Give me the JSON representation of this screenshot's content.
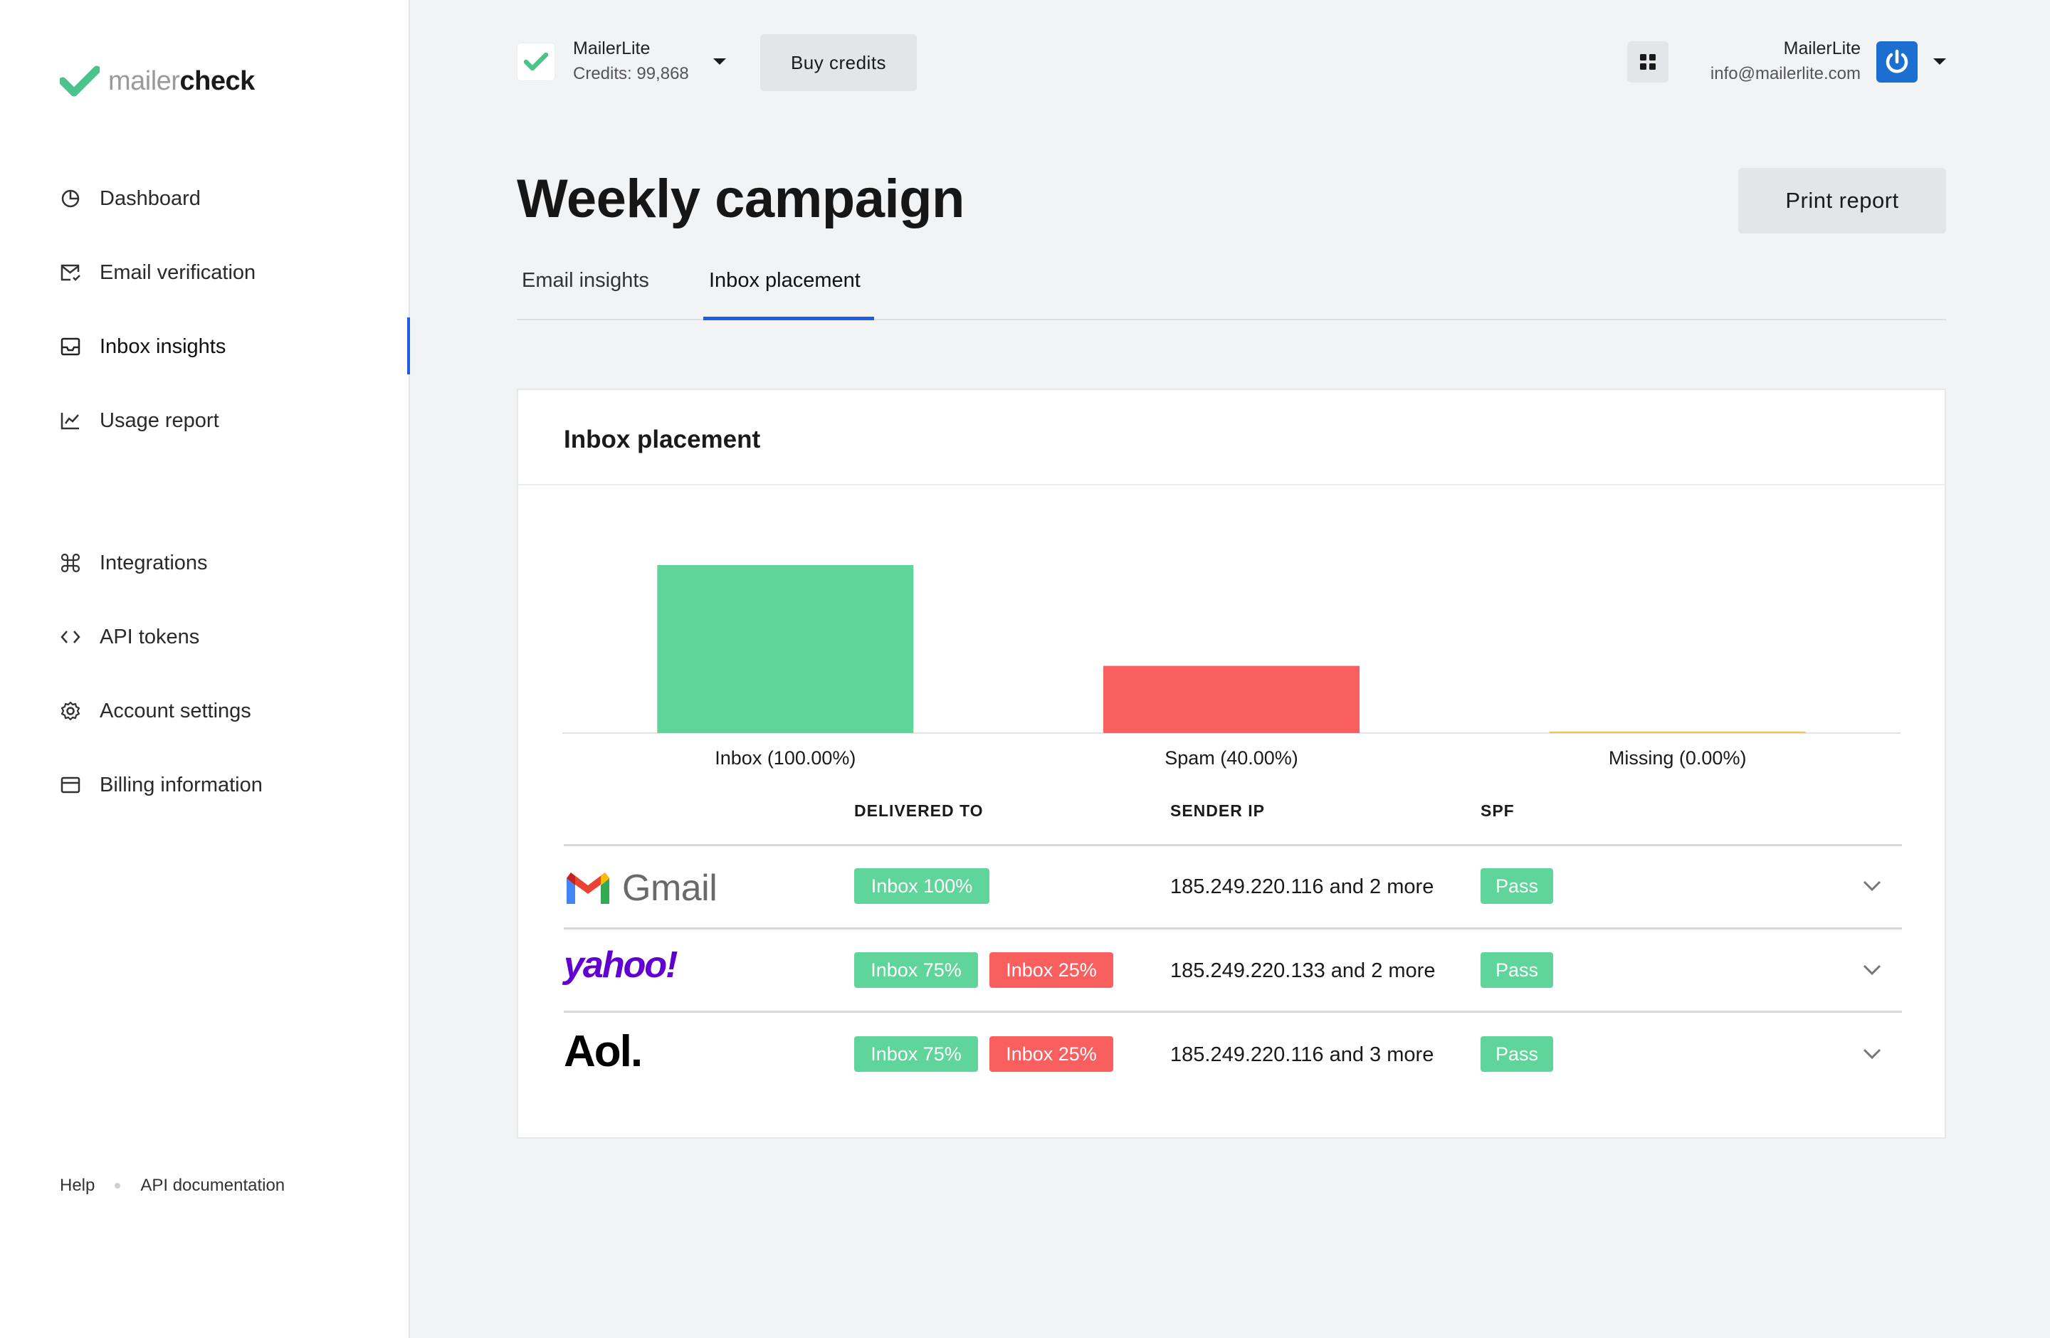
{
  "brand": {
    "logo_light": "mailer",
    "logo_bold": "check",
    "accent": "#5fd59b"
  },
  "sidebar": {
    "items": [
      {
        "label": "Dashboard",
        "icon": "pie-chart-icon"
      },
      {
        "label": "Email verification",
        "icon": "mail-check-icon"
      },
      {
        "label": "Inbox insights",
        "icon": "inbox-icon",
        "active": true
      },
      {
        "label": "Usage report",
        "icon": "line-chart-icon"
      },
      {
        "label": "Integrations",
        "icon": "command-icon"
      },
      {
        "label": "API tokens",
        "icon": "code-icon"
      },
      {
        "label": "Account settings",
        "icon": "gear-icon"
      },
      {
        "label": "Billing information",
        "icon": "billing-card-icon"
      }
    ],
    "footer": {
      "help": "Help",
      "api_docs": "API documentation"
    }
  },
  "topbar": {
    "account_name": "MailerLite",
    "credits": "Credits: 99,868",
    "buy_credits": "Buy credits",
    "user_name": "MailerLite",
    "user_email": "info@mailerlite.com"
  },
  "page": {
    "title": "Weekly campaign",
    "print_button": "Print report",
    "tabs": [
      {
        "label": "Email insights",
        "active": false
      },
      {
        "label": "Inbox placement",
        "active": true
      }
    ]
  },
  "card": {
    "title": "Inbox placement",
    "table_headers": {
      "delivered_to": "DELIVERED TO",
      "sender_ip": "SENDER IP",
      "spf": "SPF"
    },
    "rows": [
      {
        "provider": "Gmail",
        "delivered": [
          {
            "label": "Inbox 100%",
            "color": "green"
          }
        ],
        "sender_ip": "185.249.220.116 and 2 more",
        "spf": "Pass"
      },
      {
        "provider": "yahoo!",
        "delivered": [
          {
            "label": "Inbox 75%",
            "color": "green"
          },
          {
            "label": "Inbox 25%",
            "color": "red"
          }
        ],
        "sender_ip": "185.249.220.133 and 2 more",
        "spf": "Pass"
      },
      {
        "provider": "Aol.",
        "delivered": [
          {
            "label": "Inbox 75%",
            "color": "green"
          },
          {
            "label": "Inbox 25%",
            "color": "red"
          }
        ],
        "sender_ip": "185.249.220.116 and 3 more",
        "spf": "Pass"
      }
    ]
  },
  "chart_data": {
    "type": "bar",
    "categories": [
      "Inbox (100.00%)",
      "Spam (40.00%)",
      "Missing (0.00%)"
    ],
    "values": [
      100,
      40,
      0
    ],
    "colors": [
      "#5fd59b",
      "#fa5f5f",
      "#f5c542"
    ],
    "ylim": [
      0,
      100
    ],
    "grid": false,
    "title": "",
    "xlabel": "",
    "ylabel": ""
  }
}
